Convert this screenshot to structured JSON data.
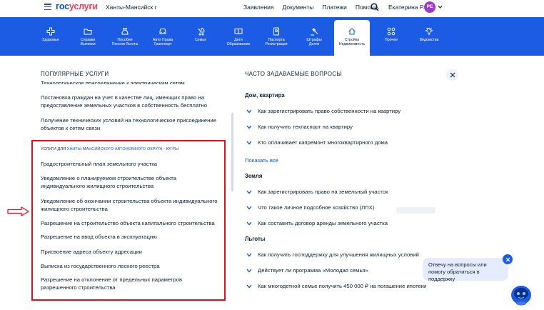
{
  "header": {
    "logo_part1": "гос",
    "logo_part2": "услуги",
    "region": "Ханты-Мансийск г",
    "nav": [
      "Заявления",
      "Документы",
      "Платежи",
      "Помощь"
    ],
    "user_name": "Екатерина Р.",
    "avatar_initials": "РЕ"
  },
  "categories": [
    {
      "label": "Здоровье",
      "icon": "health-icon"
    },
    {
      "label": "Справки\nВыписки",
      "icon": "folder-icon"
    },
    {
      "label": "Пособия\nПенсии Льготы",
      "icon": "bag-icon"
    },
    {
      "label": "Авто Права\nТранспорт",
      "icon": "car-icon"
    },
    {
      "label": "Семья",
      "icon": "stroller-icon"
    },
    {
      "label": "Дети\nОбразование",
      "icon": "book-icon"
    },
    {
      "label": "Паспорта\nРегистрация",
      "icon": "passport-icon"
    },
    {
      "label": "Штрафы\nДолги",
      "icon": "gavel-icon"
    },
    {
      "label": "Стройка\nНедвижимость",
      "icon": "house-icon"
    },
    {
      "label": "Прочее",
      "icon": "grid-icon"
    },
    {
      "label": "Ведомства",
      "icon": "emblem-icon"
    }
  ],
  "popular": {
    "title": "ПОПУЛЯРНЫЕ УСЛУГИ",
    "cut_item": "Технологическое присоединение к электрическим сетям",
    "items": [
      "Постановка граждан на учет в качестве лиц, имеющих право на предоставление земельных участков в собственность бесплатно",
      "Получение технических условий на технологическое присоединение объектов к сетям связи"
    ]
  },
  "regional": {
    "head_prefix": "УСЛУГИ ДЛЯ",
    "head_region": "ХАНТЫ-МАНСИЙСКОГО АВТОНОМНОГО ОКРУГА - ЮГРЫ",
    "items": [
      "Градостроительный план земельного участка",
      "Уведомление о планируемом строительстве объекта индивидуального жилищного строительства",
      "Уведомление об окончании строительства объекта индивидуального жилищного строительства",
      "Разрешение на строительство объекта капитального строительства",
      "Разрешение на ввод объекта в эксплуатацию",
      "Присвоение адреса объекту адресации",
      "Выписка из государственного лесного реестра",
      "Разрешение на отклонение от предельных параметров разрешенного строительства"
    ]
  },
  "faq": {
    "title": "ЧАСТО ЗАДАВАЕМЫЕ ВОПРОСЫ",
    "show_all": "Показать все",
    "groups": [
      {
        "name": "Дом, квартира",
        "items": [
          "Как зарегистрировать право собственности на квартиру",
          "Как получить техпаспорт на квартиру",
          "Кто оплачивает капремонт многоквартирного дома"
        ]
      },
      {
        "name": "Земля",
        "items": [
          "Как зарегистрировать право на земельный участок",
          "Что такое личное подсобное хозяйство (ЛПХ)",
          "Как составить договор аренды земельного участка"
        ]
      },
      {
        "name": "Льготы",
        "items": [
          "Как получить господдержку для улучшения жилищных условий",
          "Действует ли программа «Молодая семья»",
          "Как многодетной семье получить 450 000 ₽ на погашение ипотеки"
        ]
      }
    ]
  },
  "chat": {
    "bubble_text": "Отвечу на вопросы или помогу обратиться в поддержку"
  },
  "colors": {
    "brand_blue": "#0d4cd3",
    "category_bar": "#1c5ce5",
    "logo_red": "#ee3f58",
    "highlight_red": "#e1101d",
    "avatar": "#a039c8"
  }
}
